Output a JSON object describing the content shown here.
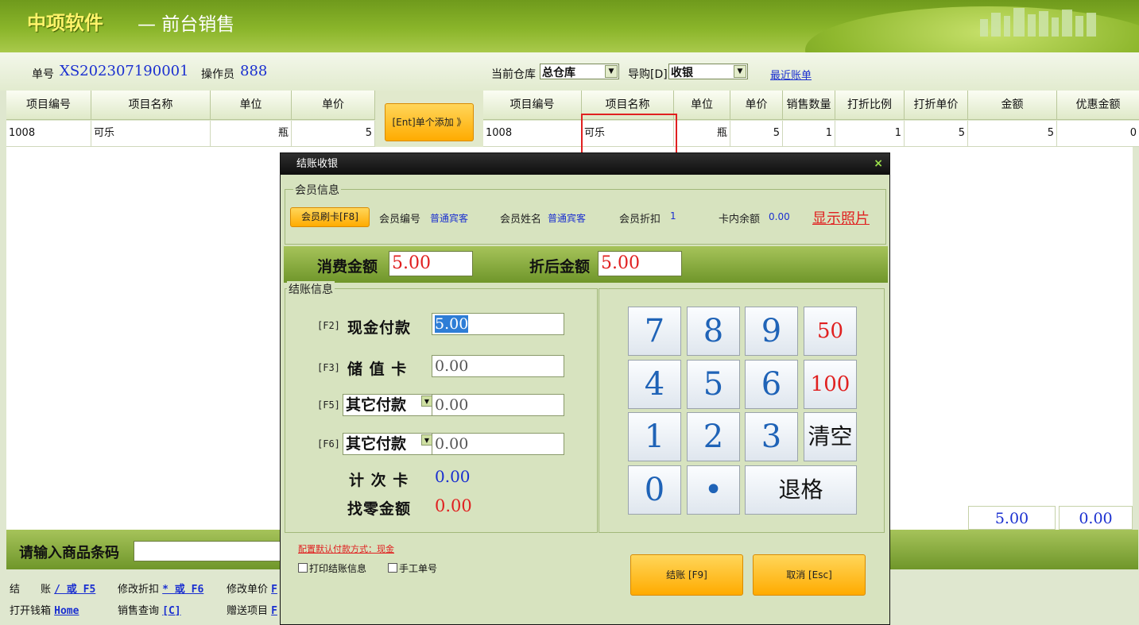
{
  "header": {
    "brand": "中项软件",
    "title": "— 前台销售"
  },
  "infobar": {
    "order_no_label": "单号",
    "order_no": "XS202307190001",
    "operator_label": "操作员",
    "operator": "888",
    "warehouse_label": "当前仓库",
    "warehouse": "总仓库",
    "guide_label": "导购[D]",
    "guide": "收银",
    "recent_bills": "最近账单"
  },
  "left_table": {
    "headers": [
      "项目编号",
      "项目名称",
      "单位",
      "单价"
    ],
    "rows": [
      [
        "1008",
        "可乐",
        "瓶",
        "5"
      ]
    ]
  },
  "add_button": "[Ent]单个添加 》",
  "right_table": {
    "headers": [
      "项目编号",
      "项目名称",
      "单位",
      "单价",
      "销售数量",
      "打折比例",
      "打折单价",
      "金额",
      "优惠金额"
    ],
    "rows": [
      [
        "1008",
        "可乐",
        "瓶",
        "5",
        "1",
        "1",
        "5",
        "5",
        "0"
      ]
    ]
  },
  "totals": {
    "amount": "5.00",
    "discount": "0.00"
  },
  "barcode": {
    "label": "请输入商品条码",
    "value": ""
  },
  "hotkeys": {
    "row1": [
      {
        "label": "结　　账",
        "key": "/ 或 F5"
      },
      {
        "label": "修改折扣",
        "key": "* 或 F6"
      },
      {
        "label": "修改单价",
        "key": "F"
      }
    ],
    "row2": [
      {
        "label": "打开钱箱",
        "key": "Home"
      },
      {
        "label": "销售查询",
        "key": "[C]"
      },
      {
        "label": "赠送项目",
        "key": "F"
      }
    ]
  },
  "dialog": {
    "title": "结账收银",
    "close": "×",
    "member": {
      "section": "会员信息",
      "swipe_button": "会员刷卡[F8]",
      "id_label": "会员编号",
      "id_value": "普通宾客",
      "name_label": "会员姓名",
      "name_value": "普通宾客",
      "discount_label": "会员折扣",
      "discount_value": "1",
      "balance_label": "卡内余额",
      "balance_value": "0.00",
      "show_photo": "显示照片"
    },
    "amounts": {
      "consume_label": "消费金额",
      "consume": "5.00",
      "after_label": "折后金额",
      "after": "5.00"
    },
    "payment": {
      "section": "结账信息",
      "cash_key": "[F2]",
      "cash_label": "现金付款",
      "cash": "5.00",
      "stored_key": "[F3]",
      "stored_label": "储 值 卡",
      "stored": "0.00",
      "other1_key": "[F5]",
      "other1_label": "其它付款",
      "other1": "0.00",
      "other2_key": "[F6]",
      "other2_label": "其它付款",
      "other2": "0.00",
      "count_card_label": "计 次 卡",
      "count_card": "0.00",
      "change_label": "找零金额",
      "change": "0.00"
    },
    "keypad": [
      "7",
      "8",
      "9",
      "50",
      "4",
      "5",
      "6",
      "100",
      "1",
      "2",
      "3",
      "清空",
      "0",
      "•",
      "退格"
    ],
    "default_pay_note": "配置默认付款方式：现金",
    "print_receipt": "打印结账信息",
    "manual_bill": "手工单号",
    "checkout_button": "结账 [F9]",
    "cancel_button": "取消 [Esc]"
  }
}
